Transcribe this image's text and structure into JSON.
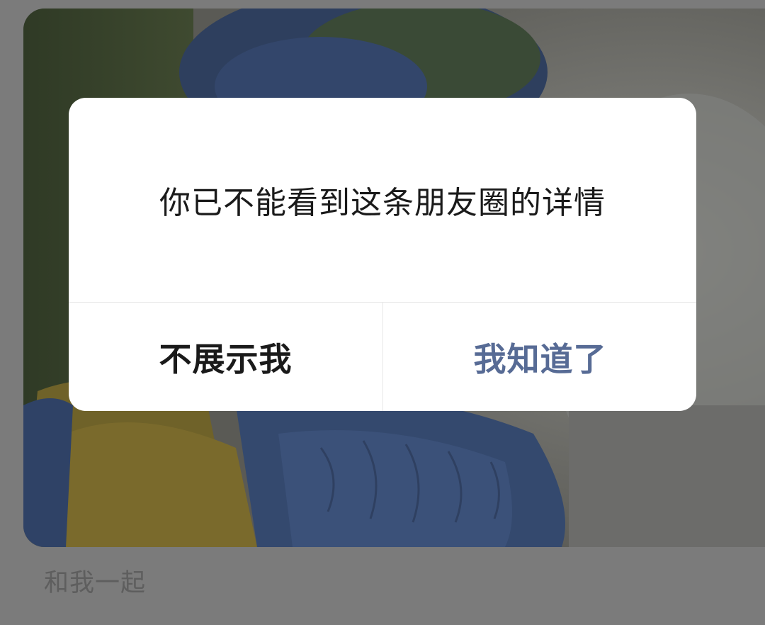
{
  "dialog": {
    "message": "你已不能看到这条朋友圈的详情",
    "secondary_button": "不展示我",
    "primary_button": "我知道了"
  },
  "post": {
    "caption": "和我一起"
  },
  "colors": {
    "primary_button_text": "#576b95",
    "secondary_button_text": "#1a1a1a",
    "message_text": "#1a1a1a",
    "caption_text": "#5e5e5e"
  }
}
